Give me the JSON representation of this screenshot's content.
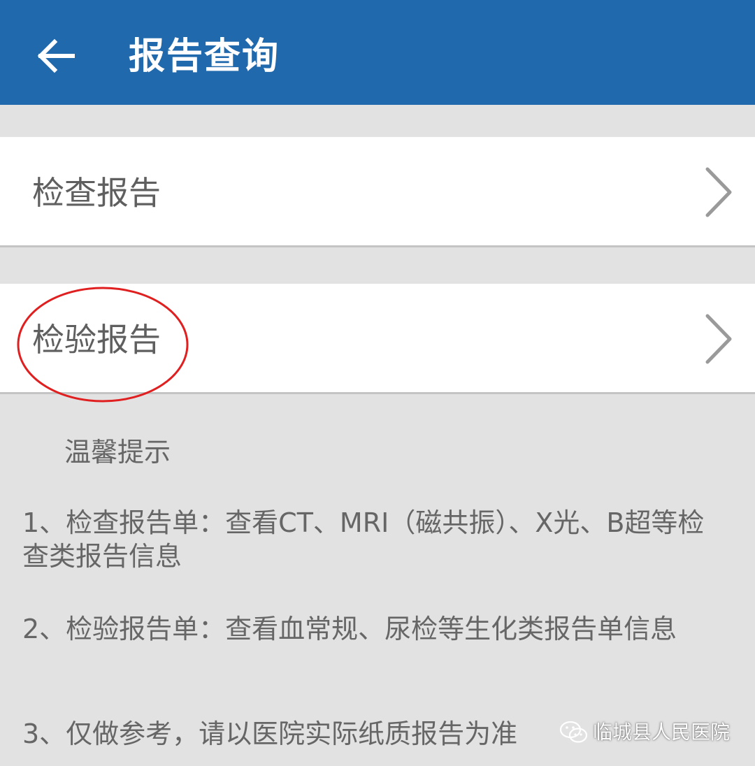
{
  "header": {
    "title": "报告查询",
    "back_icon": "arrow-left-icon",
    "background_color": "#2169ad"
  },
  "menu": {
    "items": [
      {
        "label": "检查报告",
        "icon": "chevron-right-icon"
      },
      {
        "label": "检验报告",
        "icon": "chevron-right-icon"
      }
    ],
    "highlight_color": "#e02020"
  },
  "tips": {
    "title": "温馨提示",
    "items": [
      "1、检查报告单：查看CT、MRI（磁共振）、X光、B超等检查类报告信息",
      "2、检验报告单：查看血常规、尿检等生化类报告单信息",
      "3、仅做参考，请以医院实际纸质报告为准"
    ]
  },
  "watermark": {
    "text": "临城县人民医院",
    "icon": "wechat-icon"
  }
}
